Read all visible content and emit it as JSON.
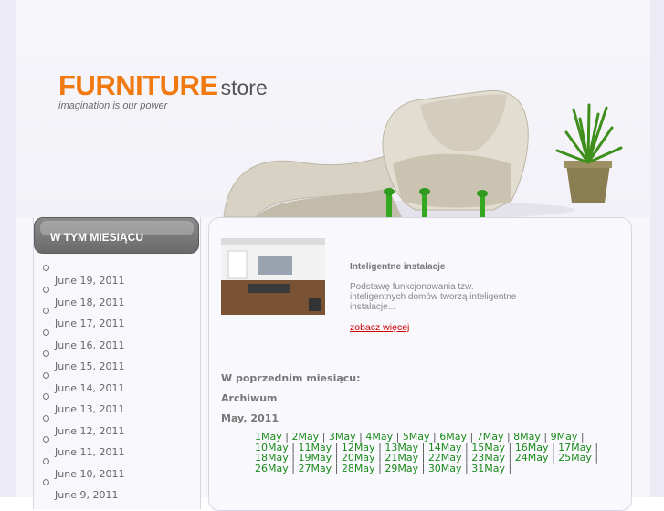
{
  "logo": {
    "main": "FURNITURE",
    "sub": "store",
    "tagline": "imagination is our power"
  },
  "sidebar": {
    "title": "W TYM MIESIĄCU",
    "items": [
      "June 19, 2011",
      "June 18, 2011",
      "June 17, 2011",
      "June 16, 2011",
      "June 15, 2011",
      "June 14, 2011",
      "June 13, 2011",
      "June 12, 2011",
      "June 11, 2011",
      "June 10, 2011",
      "June 9, 2011"
    ]
  },
  "post": {
    "title": "Inteligentne instalacje",
    "excerpt": "Podstawę funkcjonowania tzw. inteligentnych domów tworzą inteligentne instalacje...",
    "read_more": "zobacz więcej"
  },
  "archive": {
    "previous_month_label": "W poprzednim miesiącu:",
    "archive_label": "Archiwum",
    "month_label": "May, 2011",
    "days": [
      "1May",
      "2May",
      "3May",
      "4May",
      "5May",
      "6May",
      "7May",
      "8May",
      "9May",
      "10May",
      "11May",
      "12May",
      "13May",
      "14May",
      "15May",
      "16May",
      "17May",
      "18May",
      "19May",
      "20May",
      "21May",
      "22May",
      "23May",
      "24May",
      "25May",
      "26May",
      "27May",
      "28May",
      "29May",
      "30May",
      "31May"
    ],
    "separator": " | "
  },
  "colors": {
    "accent": "#f07a10",
    "link_green": "#1a8a1a",
    "link_red": "#cc0000",
    "sidebar_header": "#707070"
  }
}
